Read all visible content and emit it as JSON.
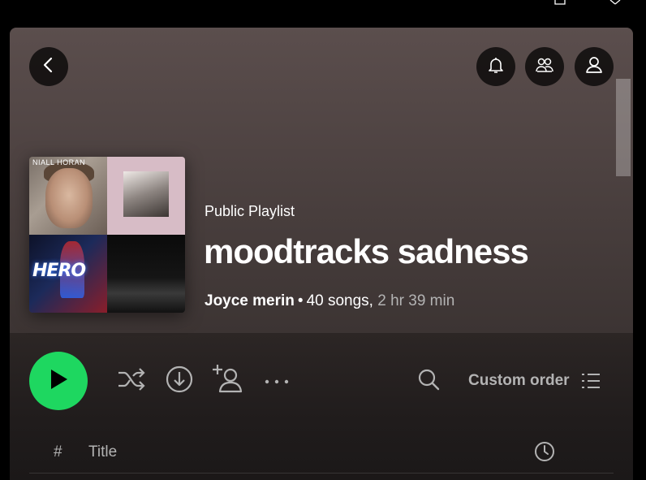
{
  "window": {
    "maximize_icon": "maximize-icon",
    "close_icon": "close-icon"
  },
  "header": {
    "back_icon": "chevron-left-icon",
    "notifications_icon": "bell-icon",
    "friends_icon": "friends-icon",
    "profile_icon": "user-icon"
  },
  "playlist": {
    "type_label": "Public Playlist",
    "title": "moodtracks sadness",
    "owner": "Joyce merin",
    "separator": "•",
    "song_count": "40 songs,",
    "duration": "2 hr 39 min",
    "cover_tiles": [
      {
        "label": "NIALL HORAN",
        "colors": [
          "#7a7068",
          "#a89d92"
        ]
      },
      {
        "label": "",
        "colors": [
          "#d7bcc6",
          "#8c8480"
        ]
      },
      {
        "label": "HERO",
        "colors": [
          "#0d1228",
          "#8a1e2a"
        ]
      },
      {
        "label": "",
        "colors": [
          "#0a0a0a",
          "#3a3a3a"
        ]
      }
    ]
  },
  "actions": {
    "play_icon": "play-icon",
    "shuffle_icon": "shuffle-icon",
    "download_icon": "download-icon",
    "add_user_icon": "add-user-icon",
    "more_icon": "more-horizontal-icon",
    "search_icon": "search-icon",
    "sort_label": "Custom order",
    "sort_icon": "list-icon"
  },
  "track_table": {
    "index_header": "#",
    "title_header": "Title",
    "duration_icon": "clock-icon"
  },
  "colors": {
    "accent": "#1ed760",
    "header_gradient_top": "#5b4e4d",
    "header_gradient_bottom": "#3c3433",
    "muted_text": "#b3b3b3"
  }
}
